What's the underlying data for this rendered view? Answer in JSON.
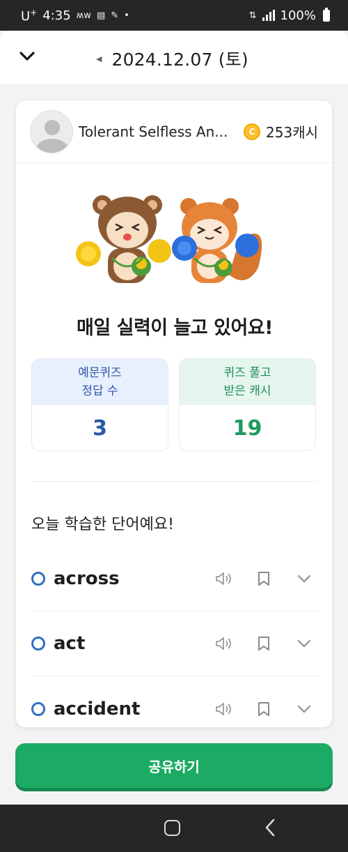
{
  "status_bar": {
    "carrier": "U",
    "carrier_sup": "+",
    "time": "4:35",
    "extra": "ʍᴡ",
    "battery_text": "100%"
  },
  "header": {
    "date": "2024.12.07 (토)"
  },
  "profile": {
    "user_name": "Tolerant Selfless An...",
    "cash": "253캐시"
  },
  "headline": "매일 실력이 늘고 있어요!",
  "stats": {
    "quiz_label_line1": "예문퀴즈",
    "quiz_label_line2": "정답 수",
    "quiz_value": "3",
    "cash_label_line1": "퀴즈 풀고",
    "cash_label_line2": "받은 캐시",
    "cash_value": "19"
  },
  "section_title": "오늘 학습한 단어예요!",
  "words": [
    {
      "word": "across"
    },
    {
      "word": "act"
    },
    {
      "word": "accident"
    }
  ],
  "share_button": "공유하기",
  "colors": {
    "accent_green": "#1cab64",
    "accent_blue": "#2b57a8",
    "circle_blue": "#2f6fbf",
    "coin": "#ffc02e"
  }
}
